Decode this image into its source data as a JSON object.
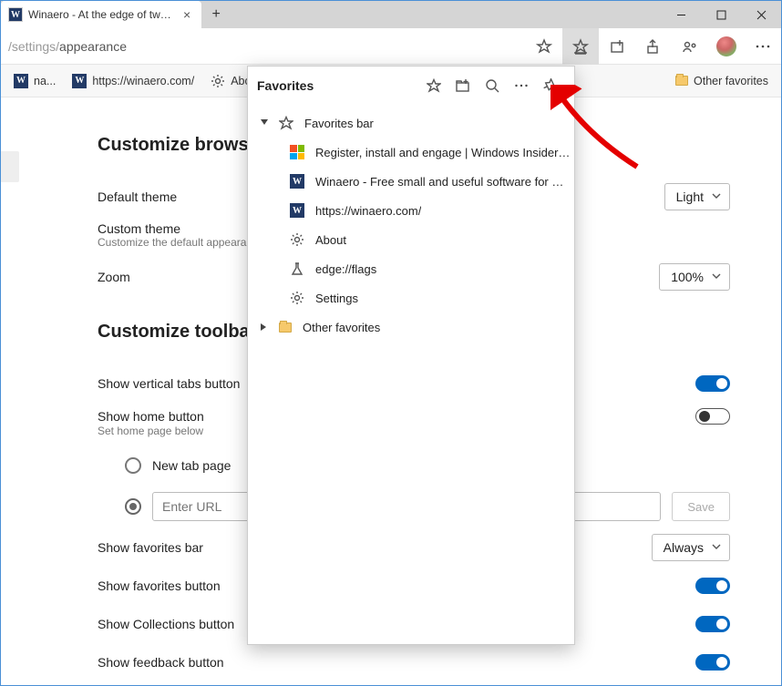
{
  "tab": {
    "title": "Winaero - At the edge of tweaki"
  },
  "addressbar": {
    "url_prefix": "/settings/",
    "url_page": "appearance"
  },
  "favbar": {
    "item0": "na...",
    "item_about": "About",
    "other": "Other favorites",
    "winaero_url": "https://winaero.com/"
  },
  "popup": {
    "title": "Favorites",
    "favorites_bar": "Favorites bar",
    "items": {
      "insider": "Register, install and engage | Windows Insider Prog...",
      "winaero_desc": "Winaero - Free small and useful software for Wind...",
      "winaero_url": "https://winaero.com/",
      "about": "About",
      "flags": "edge://flags",
      "settings": "Settings"
    },
    "other_favorites": "Other favorites"
  },
  "settings": {
    "section_browser": "Customize browser",
    "default_theme": "Default theme",
    "theme_value": "Light",
    "custom_theme": "Custom theme",
    "custom_theme_sub": "Customize the default appeara",
    "zoom": "Zoom",
    "zoom_value": "100%",
    "section_toolbar": "Customize toolbar",
    "vertical_tabs": "Show vertical tabs button",
    "home_button": "Show home button",
    "home_sub": "Set home page below",
    "new_tab_page": "New tab page",
    "enter_url_placeholder": "Enter URL",
    "save": "Save",
    "fav_bar": "Show favorites bar",
    "fav_bar_value": "Always",
    "fav_button": "Show favorites button",
    "collections_button": "Show Collections button",
    "feedback_button": "Show feedback button"
  }
}
